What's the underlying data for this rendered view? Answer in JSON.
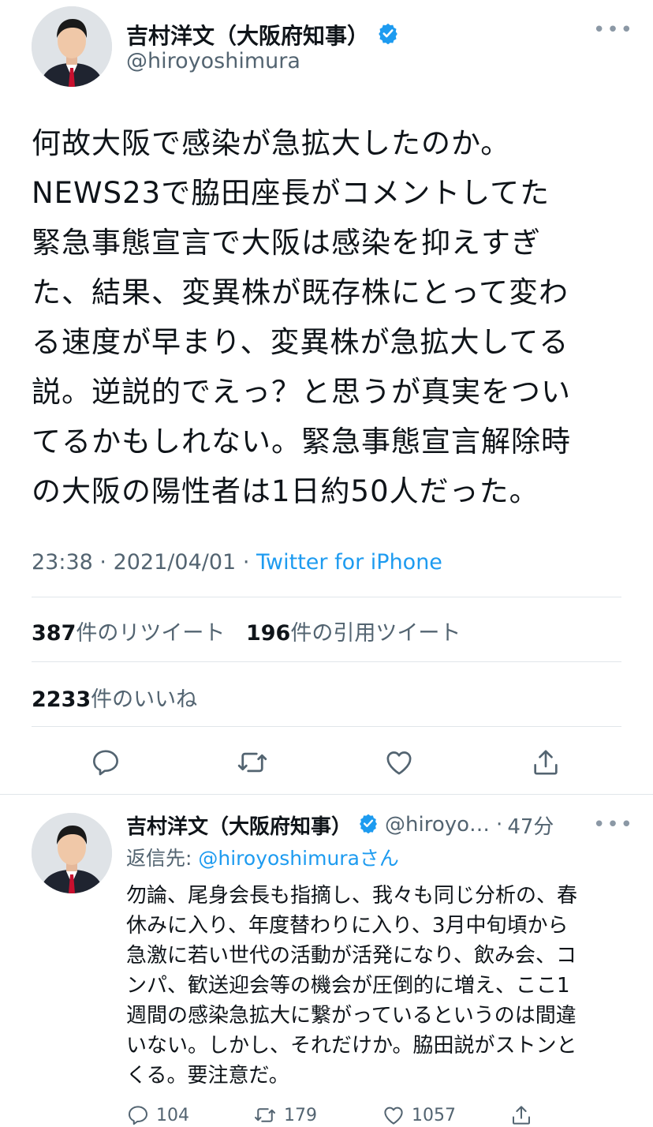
{
  "main_tweet": {
    "author_name": "吉村洋文（大阪府知事）",
    "author_handle": "@hiroyoshimura",
    "text_lines": [
      "何故大阪で感染が急拡大したのか。",
      "NEWS23で脇田座長がコメントしてた",
      "緊急事態宣言で大阪は感染を抑えすぎ",
      "た、結果、変異株が既存株にとって変わ",
      "る速度が早まり、変異株が急拡大してる",
      "説。逆説的でえっ？と思うが真実をつい",
      "てるかもしれない。緊急事態宣言解除時",
      "の大阪の陽性者は1日約50人だった。"
    ],
    "time": "23:38",
    "date": "2021/04/01",
    "separator": "·",
    "source": "Twitter for iPhone",
    "retweets_count": "387",
    "retweets_label": "件のリツイート",
    "quotes_count": "196",
    "quotes_label": "件の引用ツイート",
    "likes_count": "2233",
    "likes_label": "件のいいね"
  },
  "reply_tweet": {
    "author_name": "吉村洋文（大阪府知事）",
    "author_handle": "@hiroyo…",
    "separator": "·",
    "time_ago": "47分",
    "reply_to_prefix": "返信先: ",
    "reply_to_handle": "@hiroyoshimura",
    "reply_to_suffix": "さん",
    "text_lines": [
      "勿論、尾身会長も指摘し、我々も同じ分析の、春",
      "休みに入り、年度替わりに入り、3月中旬頃から",
      "急激に若い世代の活動が活発になり、飲み会、コ",
      "ンパ、歓送迎会等の機会が圧倒的に増え、ここ1",
      "週間の感染急拡大に繋がっているというのは間違",
      "いない。しかし、それだけか。脇田説がストンと",
      "くる。要注意だ。"
    ],
    "reply_count": "104",
    "retweet_count": "179",
    "like_count": "1057"
  },
  "colors": {
    "verified": "#1d9bf0",
    "link": "#1d9bf0",
    "divider": "#e1e6ea",
    "secondary_text": "#536471"
  }
}
